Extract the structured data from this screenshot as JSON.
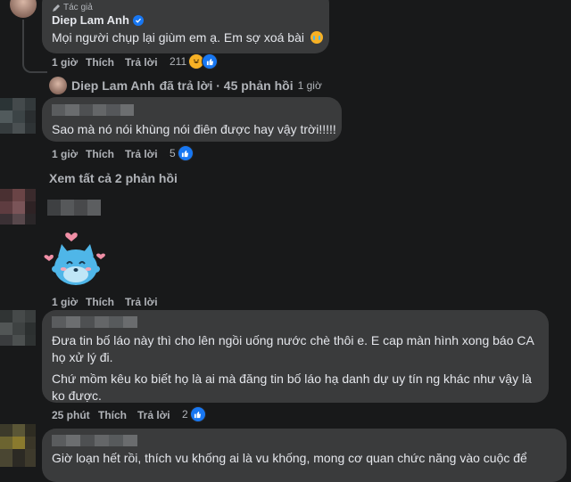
{
  "comment1": {
    "badge": "Tác giả",
    "author": "Diep Lam Anh",
    "text": "Mọi người chụp lại giùm em ạ. Em sợ xoá bài",
    "time": "1 giờ",
    "like": "Thích",
    "reply": "Trả lời",
    "reaction_count": "211",
    "reply_summary_author": "Diep Lam Anh",
    "reply_summary_text": "đã trả lời · 45 phản hồi",
    "reply_summary_time": "1 giờ"
  },
  "comment2": {
    "text": "Sao mà nó nói khùng nói điên được hay vậy trời!!!!!",
    "time": "1 giờ",
    "like": "Thích",
    "reply": "Trả lời",
    "reaction_count": "5",
    "view_replies": "Xem tất cả 2 phản hồi"
  },
  "comment3": {
    "time": "1 giờ",
    "like": "Thích",
    "reply": "Trả lời"
  },
  "comment4": {
    "text_line1": "Đưa tin bố láo này thì cho lên ngồi uống nước chè thôi e. E cap màn hình xong báo CA",
    "text_line2": "họ xử lý đi.",
    "text_line3": "Chứ mồm kêu ko biết họ là ai mà đăng tin bố láo hạ danh dự uy tín ng khác như vậy là",
    "text_line4": "ko được.",
    "time": "25 phút",
    "like": "Thích",
    "reply": "Trả lời",
    "reaction_count": "2"
  },
  "comment5": {
    "text_line1": "Giờ loạn hết rồi, thích vu khống ai là vu khống, mong cơ quan chức năng vào cuộc để"
  },
  "colors": {
    "background": "#18191a",
    "bubble": "#3a3b3c",
    "meta_text": "#b0b3b8",
    "like_blue": "#1877f2",
    "sticker_blue": "#4fb6e8"
  }
}
